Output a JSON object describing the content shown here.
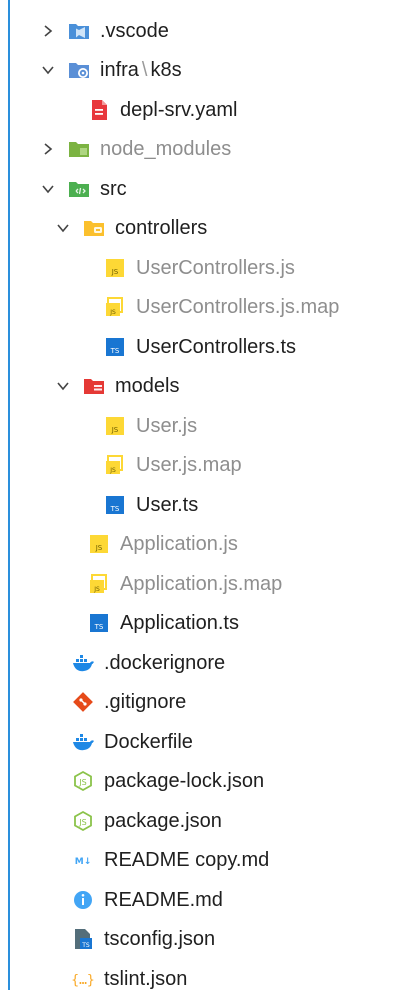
{
  "explorer": {
    "items": [
      {
        "label": ".vscode",
        "icon": "vscode-folder-icon",
        "expanded": false,
        "depth": 0,
        "dim": false
      },
      {
        "label": "infra",
        "label2": "k8s",
        "icon": "folder-config-icon",
        "expanded": true,
        "depth": 0,
        "dim": false
      },
      {
        "label": "depl-srv.yaml",
        "icon": "yaml-file-icon",
        "depth": 1,
        "dim": false
      },
      {
        "label": "node_modules",
        "icon": "node-folder-icon",
        "expanded": false,
        "depth": 0,
        "dim": true
      },
      {
        "label": "src",
        "icon": "src-folder-icon",
        "expanded": true,
        "depth": 0,
        "dim": false
      },
      {
        "label": "controllers",
        "icon": "controllers-folder-icon",
        "expanded": true,
        "depth": 1,
        "dim": false
      },
      {
        "label": "UserControllers.js",
        "icon": "js-file-icon",
        "depth": 2,
        "dim": true
      },
      {
        "label": "UserControllers.js.map",
        "icon": "js-map-file-icon",
        "depth": 2,
        "dim": true
      },
      {
        "label": "UserControllers.ts",
        "icon": "ts-file-icon",
        "depth": 2,
        "dim": false
      },
      {
        "label": "models",
        "icon": "models-folder-icon",
        "expanded": true,
        "depth": 1,
        "dim": false
      },
      {
        "label": "User.js",
        "icon": "js-file-icon",
        "depth": 2,
        "dim": true
      },
      {
        "label": "User.js.map",
        "icon": "js-map-file-icon",
        "depth": 2,
        "dim": true
      },
      {
        "label": "User.ts",
        "icon": "ts-file-icon",
        "depth": 2,
        "dim": false
      },
      {
        "label": "Application.js",
        "icon": "js-file-icon",
        "depth": 1,
        "dim": true
      },
      {
        "label": "Application.js.map",
        "icon": "js-map-file-icon",
        "depth": 1,
        "dim": true
      },
      {
        "label": "Application.ts",
        "icon": "ts-file-icon",
        "depth": 1,
        "dim": false
      },
      {
        "label": ".dockerignore",
        "icon": "docker-icon",
        "depth": 0,
        "dim": false
      },
      {
        "label": ".gitignore",
        "icon": "git-icon",
        "depth": 0,
        "dim": false
      },
      {
        "label": "Dockerfile",
        "icon": "docker-icon",
        "depth": 0,
        "dim": false
      },
      {
        "label": "package-lock.json",
        "icon": "nodejs-icon",
        "depth": 0,
        "dim": false
      },
      {
        "label": "package.json",
        "icon": "nodejs-icon",
        "depth": 0,
        "dim": false
      },
      {
        "label": "README copy.md",
        "icon": "markdown-icon",
        "depth": 0,
        "dim": false
      },
      {
        "label": "README.md",
        "icon": "info-icon",
        "depth": 0,
        "dim": false
      },
      {
        "label": "tsconfig.json",
        "icon": "tsconfig-icon",
        "depth": 0,
        "dim": false
      },
      {
        "label": "tslint.json",
        "icon": "json-braces-icon",
        "depth": 0,
        "dim": false
      }
    ]
  },
  "colors": {
    "accent_border": "#2a8fdc",
    "dim_text": "#8e8e8e",
    "text": "#1f1f1f"
  }
}
